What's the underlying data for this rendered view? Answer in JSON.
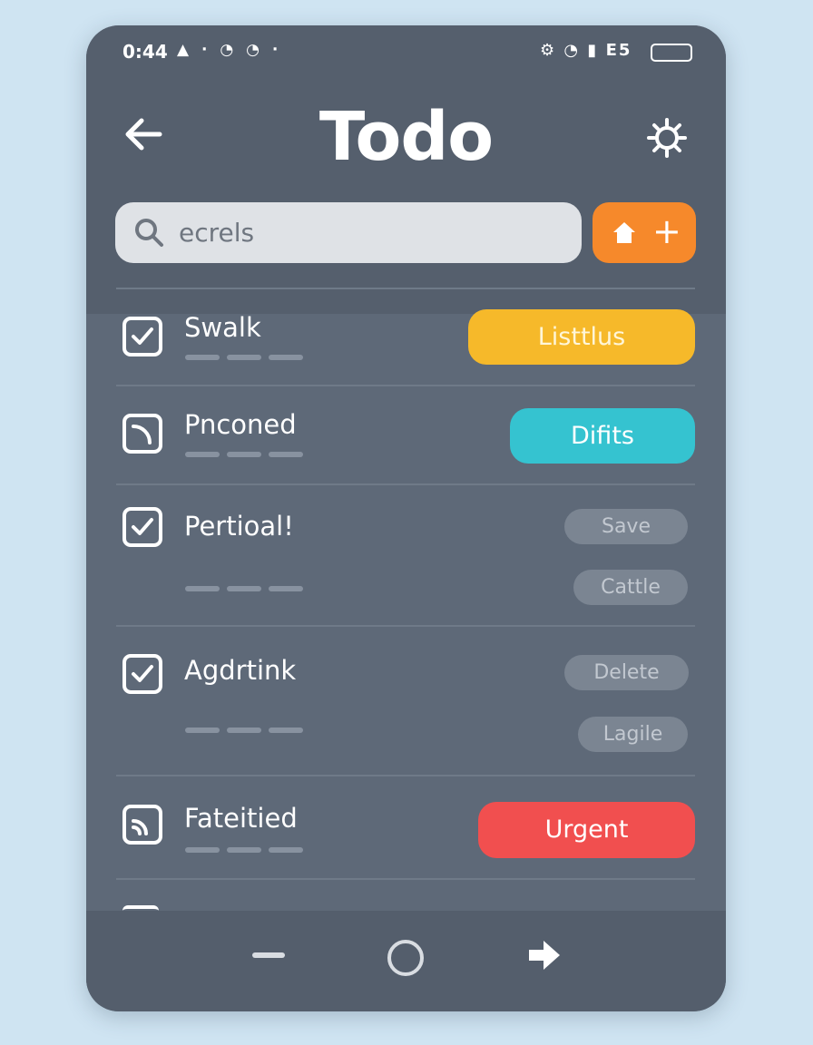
{
  "status_bar": {
    "time": "0:44",
    "left_icons": "▲ · ◔ ◔ ·",
    "right_icons": "⚙ ◔ ▮",
    "carrier": "E5"
  },
  "header": {
    "title": "Todo",
    "back_icon": "back-arrow-icon",
    "settings_icon": "gear-icon"
  },
  "search": {
    "value": "ecrels",
    "icon": "search-icon"
  },
  "add_button": {
    "home_icon": "home-icon",
    "plus": "+"
  },
  "items": [
    {
      "label": "Swalk",
      "checked": true,
      "actions": [
        {
          "label": "Listtlus",
          "color": "#f6b92a"
        }
      ]
    },
    {
      "label": "Pnconed",
      "checked": false,
      "actions": [
        {
          "label": "Difits",
          "color": "#35c3d0"
        }
      ]
    },
    {
      "label": "Pertioal!",
      "checked": true,
      "actions": [
        {
          "label": "Save"
        },
        {
          "label": "Cattle"
        }
      ]
    },
    {
      "label": "Agdrtink",
      "checked": true,
      "actions": [
        {
          "label": "Delete"
        },
        {
          "label": "Lagile"
        }
      ]
    },
    {
      "label": "Fateitied",
      "checked": false,
      "actions": [
        {
          "label": "Urgent",
          "color": "#f14f4f"
        }
      ]
    }
  ],
  "bottom_nav": {
    "left_icon": "minus-icon",
    "center_icon": "circle-home-icon",
    "right_icon": "forward-arrow-icon"
  },
  "colors": {
    "accent_orange": "#f6892b",
    "tag_yellow": "#f6b92a",
    "tag_cyan": "#35c3d0",
    "tag_red": "#f14f4f",
    "panel": "#5e6978"
  }
}
